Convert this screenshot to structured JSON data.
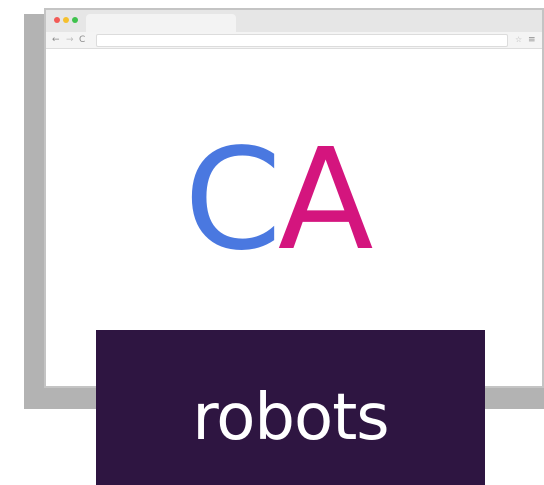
{
  "browser": {
    "nav_back_icon": "←",
    "nav_forward_icon": "→",
    "reload_icon": "C",
    "bookmark_icon": "☆",
    "menu_icon": "≡"
  },
  "logo": {
    "letter_1": "C",
    "letter_2": "A",
    "letter_1_color": "#4a78e0",
    "letter_2_color": "#d4157e"
  },
  "label": {
    "text": "robots",
    "background_color": "#2e1541"
  }
}
